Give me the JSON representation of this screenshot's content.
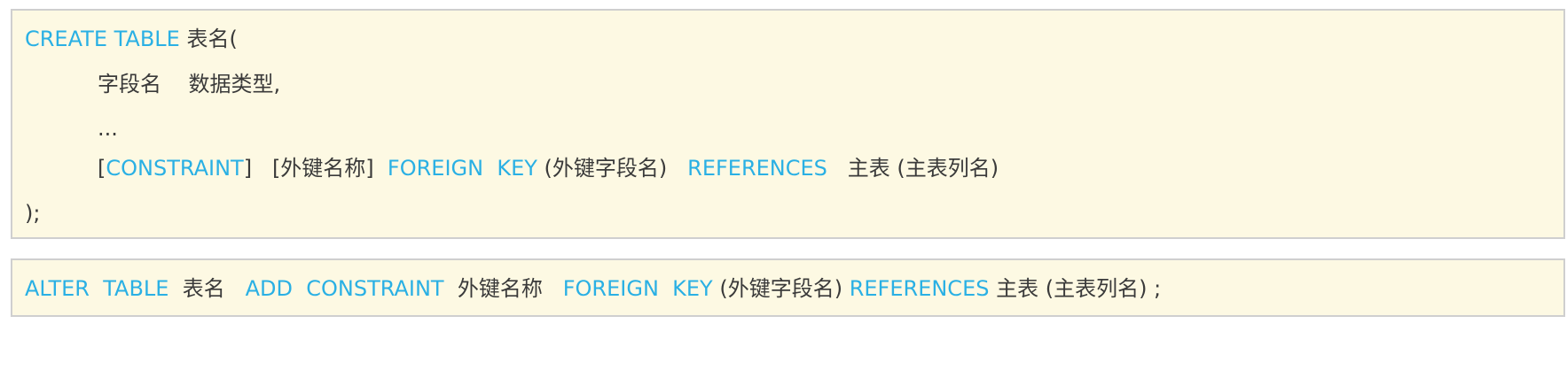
{
  "create_block": {
    "line1": {
      "kw1": "CREATE TABLE",
      "tx1": " 表名("
    },
    "line2": {
      "tx1": "字段名    数据类型,"
    },
    "line3": {
      "tx1": "..."
    },
    "line4": {
      "tx1": "[",
      "kw1": "CONSTRAINT",
      "tx2": "]   [外键名称]  ",
      "kw2": "FOREIGN  KEY",
      "tx3": " (外键字段名)   ",
      "kw3": "REFERENCES",
      "tx4": "   主表 (主表列名)"
    },
    "line5": {
      "tx1": ");"
    }
  },
  "alter_block": {
    "kw1": "ALTER  TABLE",
    "tx1": "  表名   ",
    "kw2": "ADD  CONSTRAINT",
    "tx2": "  外键名称   ",
    "kw3": "FOREIGN  KEY",
    "tx3": " (外键字段名) ",
    "kw4": "REFERENCES",
    "tx4": " 主表 (主表列名) ;"
  },
  "colors": {
    "keyword": "#2ab0e4",
    "text": "#3a3a3a",
    "box_background": "#fdf9e3",
    "box_border": "#cfcfcf"
  }
}
